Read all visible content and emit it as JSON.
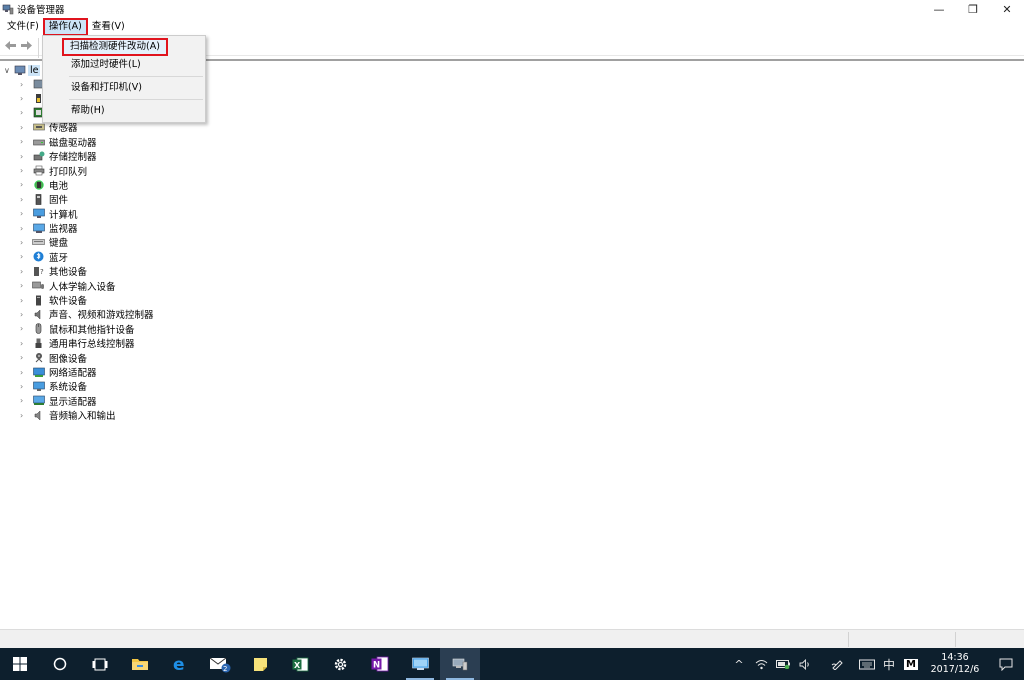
{
  "window": {
    "title": "设备管理器",
    "controls": {
      "minimize": "—",
      "restore": "❐",
      "close": "✕"
    }
  },
  "menubar": {
    "items": [
      {
        "label": "文件(F)"
      },
      {
        "label": "操作(A)"
      },
      {
        "label": "查看(V)"
      }
    ]
  },
  "action_menu": {
    "items": [
      {
        "label": "扫描检测硬件改动(A)"
      },
      {
        "label": "添加过时硬件(L)"
      },
      {
        "label": "设备和打印机(V)"
      },
      {
        "label": "帮助(H)"
      }
    ]
  },
  "tree": {
    "root_label": "le",
    "categories": [
      {
        "label": "",
        "icon": "generic-device-icon"
      },
      {
        "label": "",
        "icon": "battery-device-icon"
      },
      {
        "label": "",
        "icon": "processor-icon"
      },
      {
        "label": "传感器",
        "icon": "sensor-icon"
      },
      {
        "label": "磁盘驱动器",
        "icon": "disk-drive-icon"
      },
      {
        "label": "存储控制器",
        "icon": "storage-controller-icon"
      },
      {
        "label": "打印队列",
        "icon": "printer-icon"
      },
      {
        "label": "电池",
        "icon": "battery-icon"
      },
      {
        "label": "固件",
        "icon": "firmware-icon"
      },
      {
        "label": "计算机",
        "icon": "computer-icon"
      },
      {
        "label": "监视器",
        "icon": "monitor-icon"
      },
      {
        "label": "键盘",
        "icon": "keyboard-icon"
      },
      {
        "label": "蓝牙",
        "icon": "bluetooth-icon"
      },
      {
        "label": "其他设备",
        "icon": "other-devices-icon"
      },
      {
        "label": "人体学输入设备",
        "icon": "hid-icon"
      },
      {
        "label": "软件设备",
        "icon": "software-device-icon"
      },
      {
        "label": "声音、视频和游戏控制器",
        "icon": "speaker-icon"
      },
      {
        "label": "鼠标和其他指针设备",
        "icon": "mouse-icon"
      },
      {
        "label": "通用串行总线控制器",
        "icon": "usb-icon"
      },
      {
        "label": "图像设备",
        "icon": "camera-icon"
      },
      {
        "label": "网络适配器",
        "icon": "network-adapter-icon"
      },
      {
        "label": "系统设备",
        "icon": "system-device-icon"
      },
      {
        "label": "显示适配器",
        "icon": "display-adapter-icon"
      },
      {
        "label": "音频输入和输出",
        "icon": "audio-io-icon"
      }
    ]
  },
  "taskbar": {
    "mail_badge": "2",
    "ime": "中",
    "ime_mode": "M",
    "time": "14:36",
    "date": "2017/12/6"
  },
  "colors": {
    "highlight_red": "#e0141e",
    "selection_blue": "#cce4f7",
    "taskbar_bg": "#0d1f2d"
  }
}
